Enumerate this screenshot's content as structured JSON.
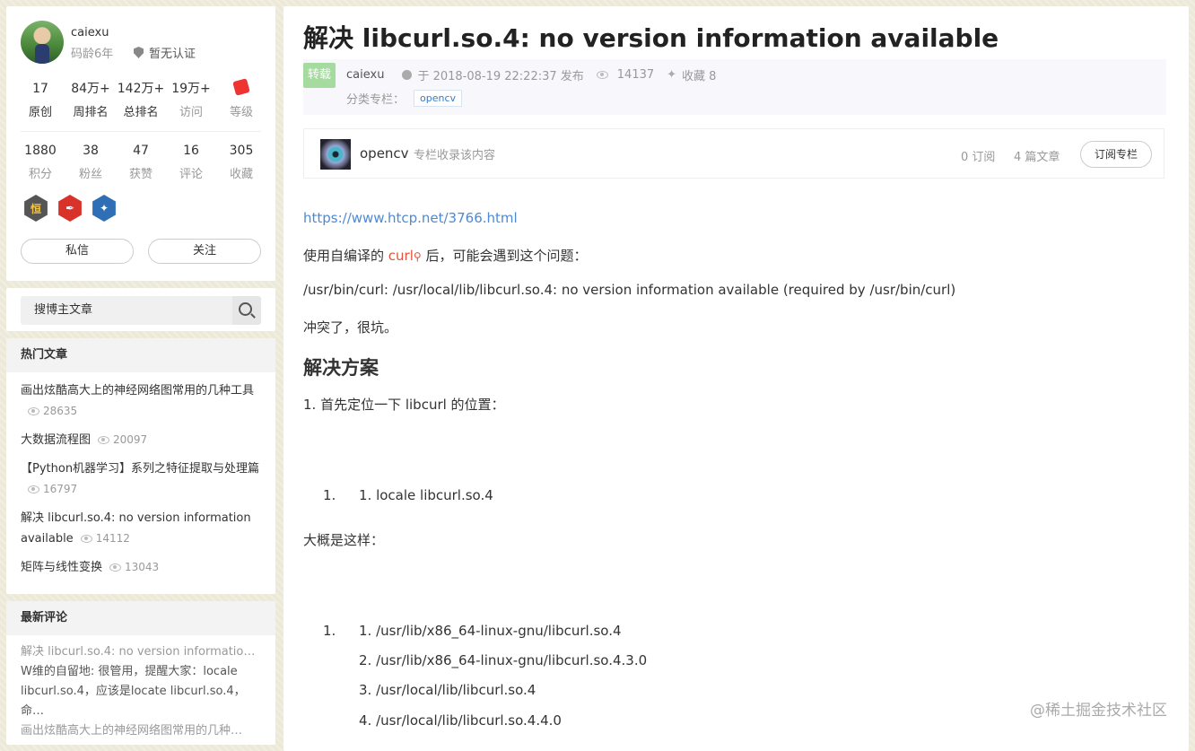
{
  "profile": {
    "name": "caiexu",
    "code_age": "码龄6年",
    "cert": "暂无认证",
    "stats1": [
      {
        "value": "17",
        "label": "原创"
      },
      {
        "value": "84万+",
        "label": "周排名"
      },
      {
        "value": "142万+",
        "label": "总排名"
      },
      {
        "value": "19万+",
        "label": "访问"
      },
      {
        "value": "",
        "label": "等级"
      }
    ],
    "stats2": [
      {
        "value": "1880",
        "label": "积分"
      },
      {
        "value": "38",
        "label": "粉丝"
      },
      {
        "value": "47",
        "label": "获赞"
      },
      {
        "value": "16",
        "label": "评论"
      },
      {
        "value": "305",
        "label": "收藏"
      }
    ],
    "badges": [
      {
        "icon": "persistence-badge-icon",
        "text": "恒",
        "color": "#555"
      },
      {
        "icon": "pen-badge-icon",
        "text": "✒",
        "color": "#d9322b"
      },
      {
        "icon": "blue-badge-icon",
        "text": "✦",
        "color": "#2f6fb5"
      }
    ],
    "message_button": "私信",
    "follow_button": "关注"
  },
  "search": {
    "placeholder": "搜博主文章"
  },
  "hot": {
    "title": "热门文章",
    "items": [
      {
        "title": "画出炫酷高大上的神经网络图常用的几种工具",
        "views": "28635"
      },
      {
        "title": "大数据流程图",
        "views": "20097"
      },
      {
        "title": "【Python机器学习】系列之特征提取与处理篇",
        "views": "16797"
      },
      {
        "title": "解决 libcurl.so.4: no version information available",
        "views": "14112"
      },
      {
        "title": "矩阵与线性变换",
        "views": "13043"
      }
    ]
  },
  "comments": {
    "title": "最新评论",
    "items": [
      {
        "article": "解决 libcurl.so.4: no version information a…",
        "body": "W维的自留地: 很管用，提醒大家：locale libcurl.so.4，应该是locate libcurl.so.4，命…"
      },
      {
        "article": "画出炫酷高大上的神经网络图常用的几种…",
        "body": ""
      }
    ]
  },
  "article": {
    "title": "解决 libcurl.so.4: no version information available",
    "repost_tag": "转载",
    "author": "caiexu",
    "date": "于 2018-08-19 22:22:37 发布",
    "views": "14137",
    "favorites": "收藏 8",
    "category_label": "分类专栏：",
    "category": "opencv"
  },
  "column": {
    "name": "opencv",
    "desc": "专栏收录该内容",
    "subs": "0 订阅",
    "posts": "4 篇文章",
    "subscribe": "订阅专栏"
  },
  "content": {
    "link": "https://www.htcp.net/3766.html",
    "p1_pre": "使用自编译的 ",
    "p1_kw": "curl",
    "p1_post": " 后，可能会遇到这个问题：",
    "p2": "/usr/bin/curl: /usr/local/lib/libcurl.so.4: no version information available (required by /usr/bin/curl)",
    "p3": "冲突了，很坑。",
    "h2": "解决方案",
    "p4": "1. 首先定位一下 libcurl 的位置：",
    "code1_num": "1.",
    "code1": "1. locale libcurl.so.4",
    "p5": "大概是这样：",
    "code2_num": "1.",
    "code2": [
      "1. /usr/lib/x86_64-linux-gnu/libcurl.so.4",
      "2. /usr/lib/x86_64-linux-gnu/libcurl.so.4.3.0",
      "3. /usr/local/lib/libcurl.so.4",
      "4. /usr/local/lib/libcurl.so.4.4.0"
    ]
  },
  "watermark": "@稀土掘金技术社区"
}
